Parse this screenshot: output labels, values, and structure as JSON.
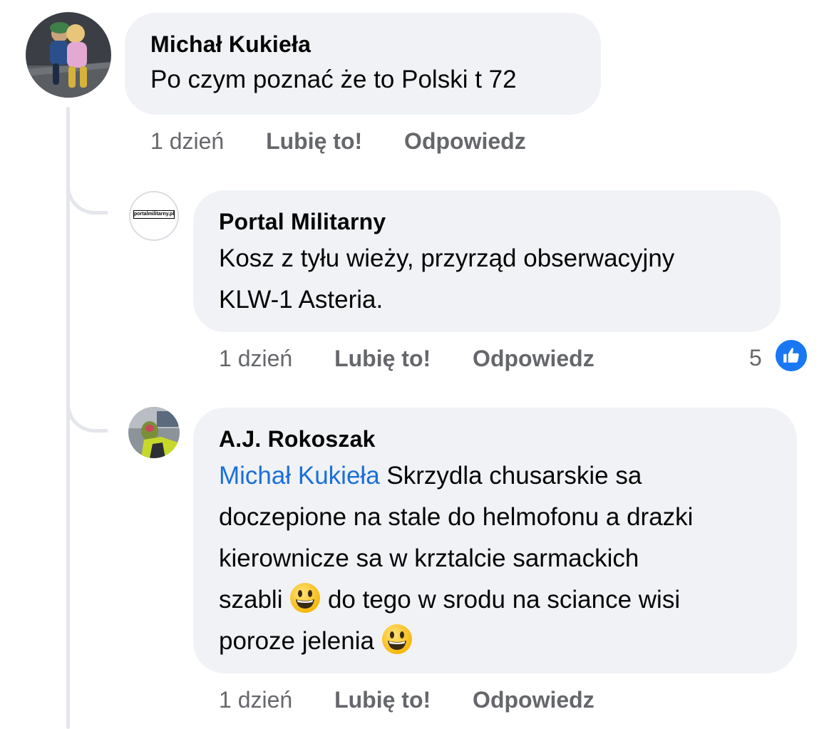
{
  "comments": [
    {
      "author": "Michał Kukieła",
      "text": "Po czym poznać że to Polski t 72",
      "time": "1 dzień",
      "like_label": "Lubię to!",
      "reply_label": "Odpowiedz"
    },
    {
      "author": "Portal Militarny",
      "avatar_text": "portalmilitarny.pl",
      "text_line1": "Kosz z tyłu wieży, przyrząd obserwacyjny",
      "text_line2": "KLW-1 Asteria.",
      "time": "1 dzień",
      "like_label": "Lubię to!",
      "reply_label": "Odpowiedz",
      "reaction_count": "5",
      "reaction_icon": "thumbs-up-icon"
    },
    {
      "author": "A.J. Rokoszak",
      "mention": "Michał Kukieła",
      "text_line1": " Skrzydla chusarskie sa",
      "text_line2": "doczepione na stale do helmofonu a drazki",
      "text_line3": "kierownicze sa w krztalcie sarmackich",
      "text_line4a": "szabli ",
      "text_line4b": " do tego w srodu na sciance wisi",
      "text_line5": "poroze jelenia ",
      "emoji": "grinning-face-emoji",
      "time": "1 dzień",
      "like_label": "Lubię to!",
      "reply_label": "Odpowiedz"
    }
  ],
  "colors": {
    "bubble": "#f0f2f5",
    "meta_text": "#65676b",
    "mention": "#1b6fd8",
    "like_blue": "#1877f2",
    "thread_line": "#e4e6eb"
  }
}
